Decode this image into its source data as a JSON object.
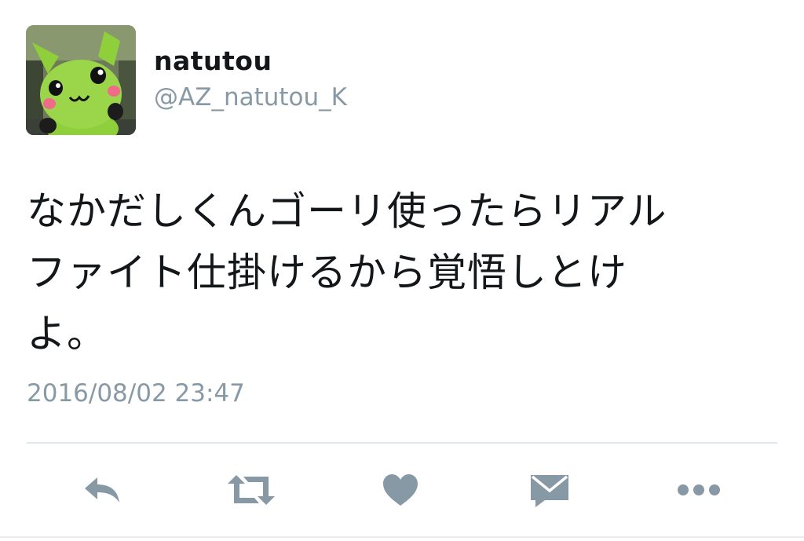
{
  "user": {
    "display_name": "natutou",
    "handle": "@AZ_natutou_K"
  },
  "tweet": {
    "text_lines": [
      "なかだしくんゴーリ使ったらリアル",
      "ファイト仕掛けるから覚悟しとけ",
      "よ。"
    ],
    "timestamp": "2016/08/02 23:47"
  },
  "actions": [
    {
      "name": "reply",
      "icon": "reply-icon"
    },
    {
      "name": "retweet",
      "icon": "retweet-icon"
    },
    {
      "name": "like",
      "icon": "heart-icon"
    },
    {
      "name": "direct-message",
      "icon": "envelope-icon"
    },
    {
      "name": "more",
      "icon": "ellipsis-icon"
    }
  ],
  "colors": {
    "text": "#14171a",
    "secondary": "#8899a6",
    "icon": "#8899a6",
    "divider": "#e1e8ed",
    "avatar_character": "#8fcf3c"
  }
}
